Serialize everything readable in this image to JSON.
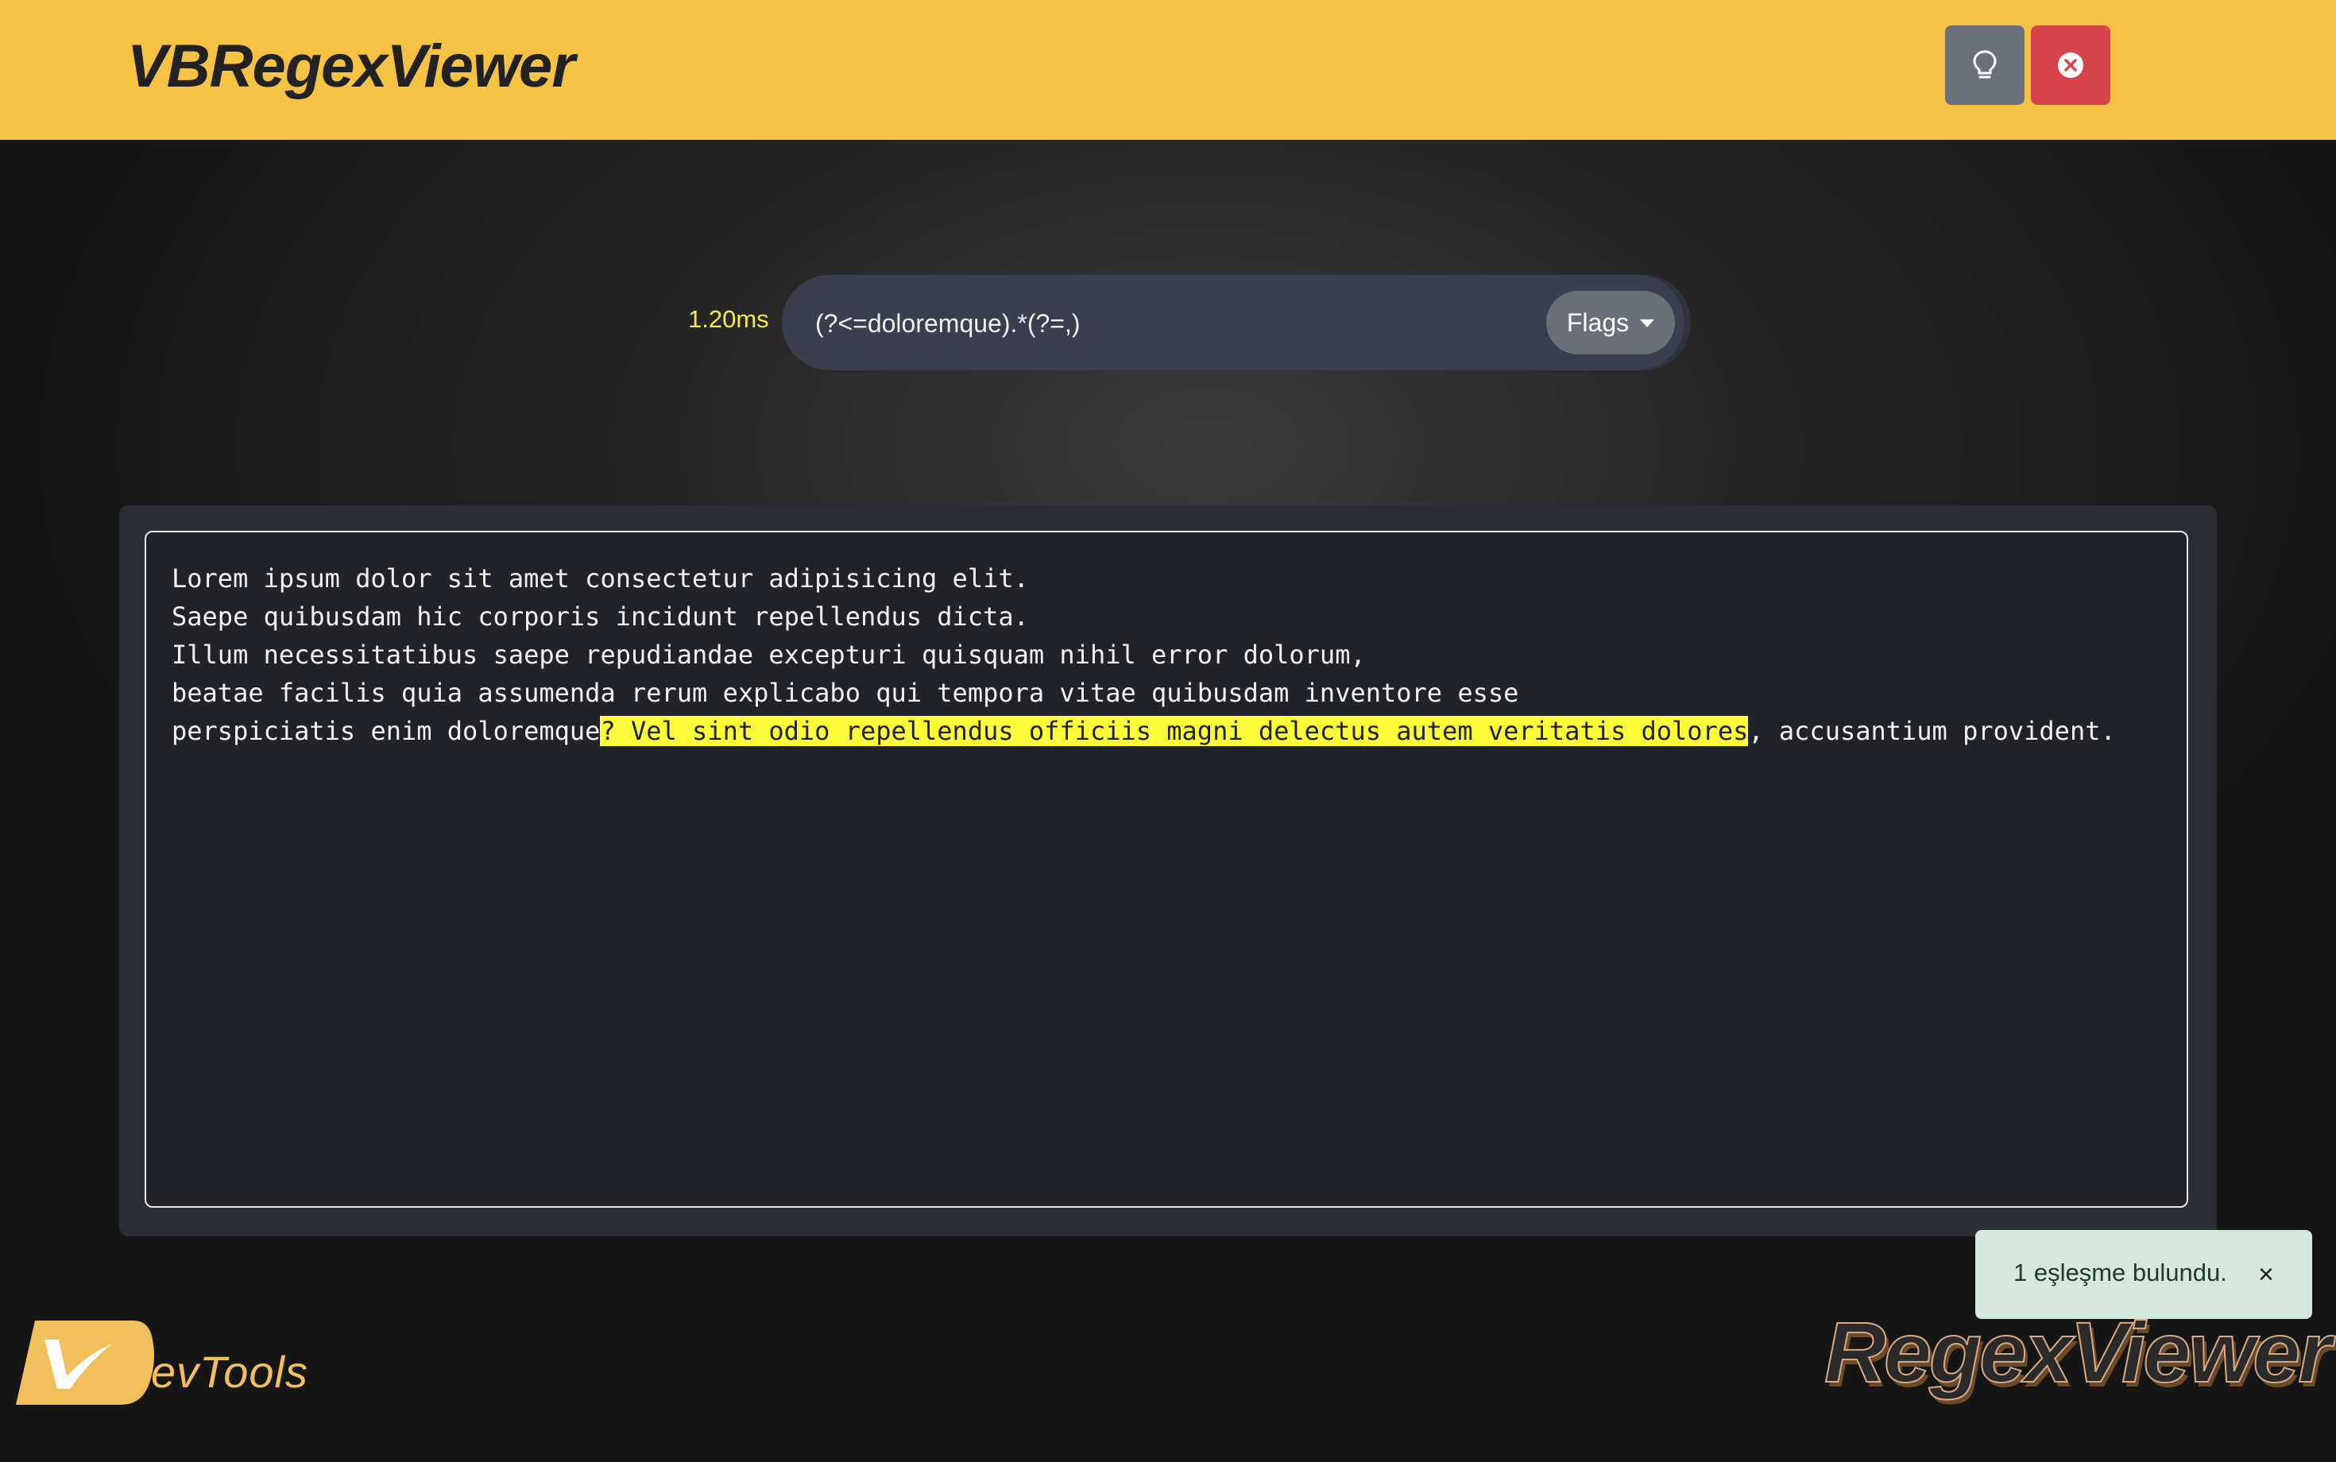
{
  "header": {
    "title": "VBRegexViewer",
    "hint_icon": "lightbulb-icon",
    "close_icon": "close-circle-icon",
    "accent_color": "#f5c244",
    "close_color": "#d9434b"
  },
  "regex": {
    "timing": "1.20ms",
    "pattern": "(?<=doloremque).*(?=,)",
    "flags_label": "Flags"
  },
  "editor": {
    "line1": "Lorem ipsum dolor sit amet consectetur adipisicing elit.",
    "line2": "Saepe quibusdam hic corporis incidunt repellendus dicta.",
    "line3": "Illum necessitatibus saepe repudiandae excepturi quisquam nihil error dolorum,",
    "line4": "beatae facilis quia assumenda rerum explicabo qui tempora vitae quibusdam inventore esse",
    "line5_before": "perspiciatis enim doloremque",
    "line5_match": "? Vel sint odio repellendus officiis magni delectus autem veritatis dolores",
    "line5_after": ", accusantium provident.",
    "highlight_color": "#fbfb3a"
  },
  "toast": {
    "message": "1 eşleşme bulundu.",
    "close_label": "×"
  },
  "footer": {
    "dev_logo_text": "evTools",
    "brand_text": "RegexViewer"
  }
}
